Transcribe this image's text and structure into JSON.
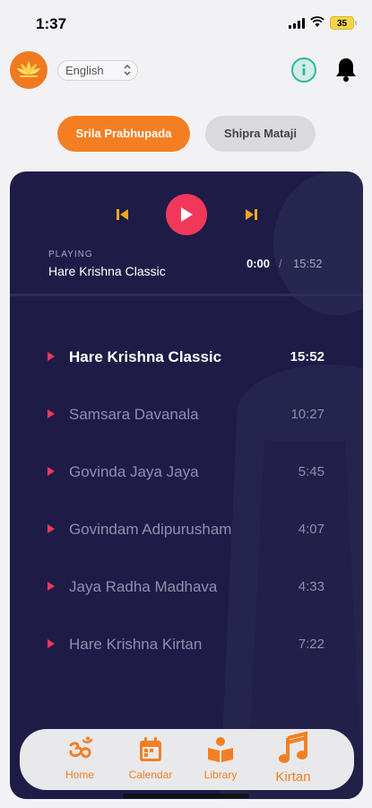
{
  "status": {
    "time": "1:37",
    "battery": "35"
  },
  "header": {
    "language": "English",
    "colors": {
      "brand": "#ef7a20",
      "info": "#34b59c"
    }
  },
  "tabs": [
    {
      "label": "Srila Prabhupada",
      "active": true
    },
    {
      "label": "Shipra Mataji",
      "active": false
    }
  ],
  "player": {
    "status_label": "PLAYING",
    "current_title": "Hare Krishna Classic",
    "elapsed": "0:00",
    "separator": "/",
    "total": "15:52",
    "accent": "#f2385a"
  },
  "tracks": [
    {
      "title": "Hare Krishna Classic",
      "duration": "15:52",
      "active": true
    },
    {
      "title": "Samsara Davanala",
      "duration": "10:27",
      "active": false
    },
    {
      "title": "Govinda Jaya Jaya",
      "duration": "5:45",
      "active": false
    },
    {
      "title": "Govindam Adipurusham",
      "duration": "4:07",
      "active": false
    },
    {
      "title": "Jaya Radha Madhava",
      "duration": "4:33",
      "active": false
    },
    {
      "title": "Hare Krishna Kirtan",
      "duration": "7:22",
      "active": false
    }
  ],
  "nav": [
    {
      "label": "Home",
      "icon": "om-icon"
    },
    {
      "label": "Calendar",
      "icon": "calendar-icon"
    },
    {
      "label": "Library",
      "icon": "book-reader-icon"
    },
    {
      "label": "Kirtan",
      "icon": "music-note-icon",
      "active": true
    }
  ]
}
